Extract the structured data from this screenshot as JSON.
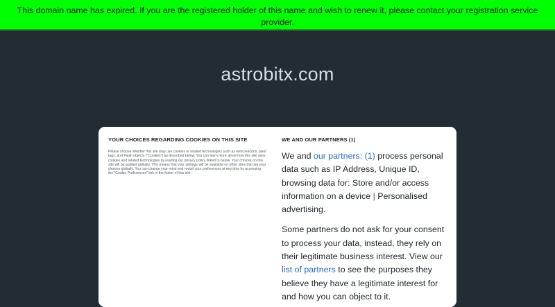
{
  "banner": {
    "message": "This domain name has expired. If you are the registered holder of this name and wish to renew it, please contact your registration service provider."
  },
  "domain": {
    "name": "astrobitx.com"
  },
  "cookie_panel": {
    "left": {
      "heading": "YOUR CHOICES REGARDING COOKIES ON THIS SITE",
      "description": "Please choose whether this site may use cookies or related technologies such as web beacons, pixel tags, and Flash objects (\"Cookies\") as described below. You can learn more about how this site uses cookies and related technologies by reading our privacy policy linked to below. Your choices on this site will be applied globally. This means that your settings will be available on other sites that set your choices globally. You can change your mind and revisit your preferences at any time by accessing the \"Cookie Preferences\" link in the footer of this site."
    },
    "right": {
      "heading": "WE AND OUR PARTNERS (1)",
      "p1_prefix": "We and ",
      "p1_link": "our partners: (1)",
      "p1_middle": " process personal data such as IP Address, Unique ID, browsing data for: Store and/or access information on a device ",
      "p1_separator": "|",
      "p1_suffix": " Personalised advertising.",
      "p2_prefix": "Some partners do not ask for your consent to process your data, instead, they rely on their legitimate business interest. View our ",
      "p2_link": "list of partners",
      "p2_suffix": " to see the purposes they believe they have a legitimate interest for and how you can object to it."
    }
  },
  "colors": {
    "banner_bg": "#00ff00",
    "page_bg": "#232b33",
    "panel_bg": "#ffffff",
    "link": "#2d6bc4"
  }
}
